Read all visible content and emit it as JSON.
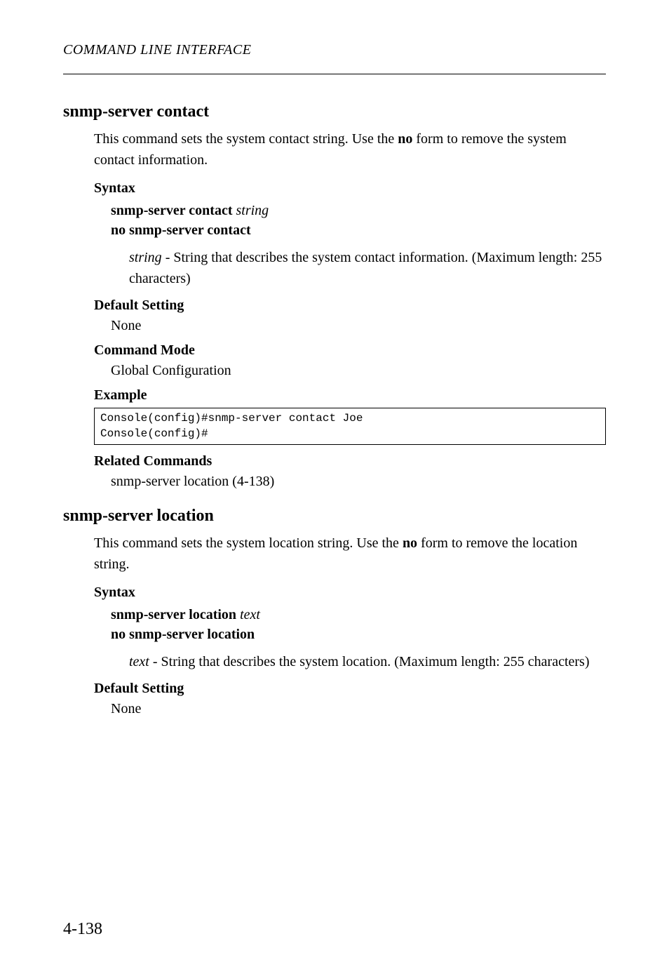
{
  "header": {
    "title": "COMMAND LINE INTERFACE"
  },
  "section1": {
    "heading": "snmp-server contact",
    "intro_part1": "This command sets the system contact string. Use the ",
    "intro_bold": "no",
    "intro_part2": " form to remove the system contact information.",
    "syntax_label": "Syntax",
    "syntax_line1_bold": "snmp-server contact",
    "syntax_line1_italic": "string",
    "syntax_line2_bold": "no snmp-server contact",
    "param_italic": "string",
    "param_text": " - String that describes the system contact information. (Maximum length: 255 characters)",
    "default_label": "Default Setting",
    "default_value": "None",
    "command_mode_label": "Command Mode",
    "command_mode_value": "Global Configuration",
    "example_label": "Example",
    "example_code": "Console(config)#snmp-server contact Joe\nConsole(config)#",
    "related_label": "Related Commands",
    "related_value": "snmp-server location (4-138)"
  },
  "section2": {
    "heading": "snmp-server location",
    "intro_part1": "This command sets the system location string. Use the ",
    "intro_bold": "no",
    "intro_part2": " form to remove the location string.",
    "syntax_label": "Syntax",
    "syntax_line1_bold": "snmp-server location",
    "syntax_line1_italic": "text",
    "syntax_line2_bold": "no snmp-server location",
    "param_italic": "text",
    "param_text": " - String that describes the system location. (Maximum length: 255 characters)",
    "default_label": "Default Setting",
    "default_value": "None"
  },
  "page_number": "4-138"
}
